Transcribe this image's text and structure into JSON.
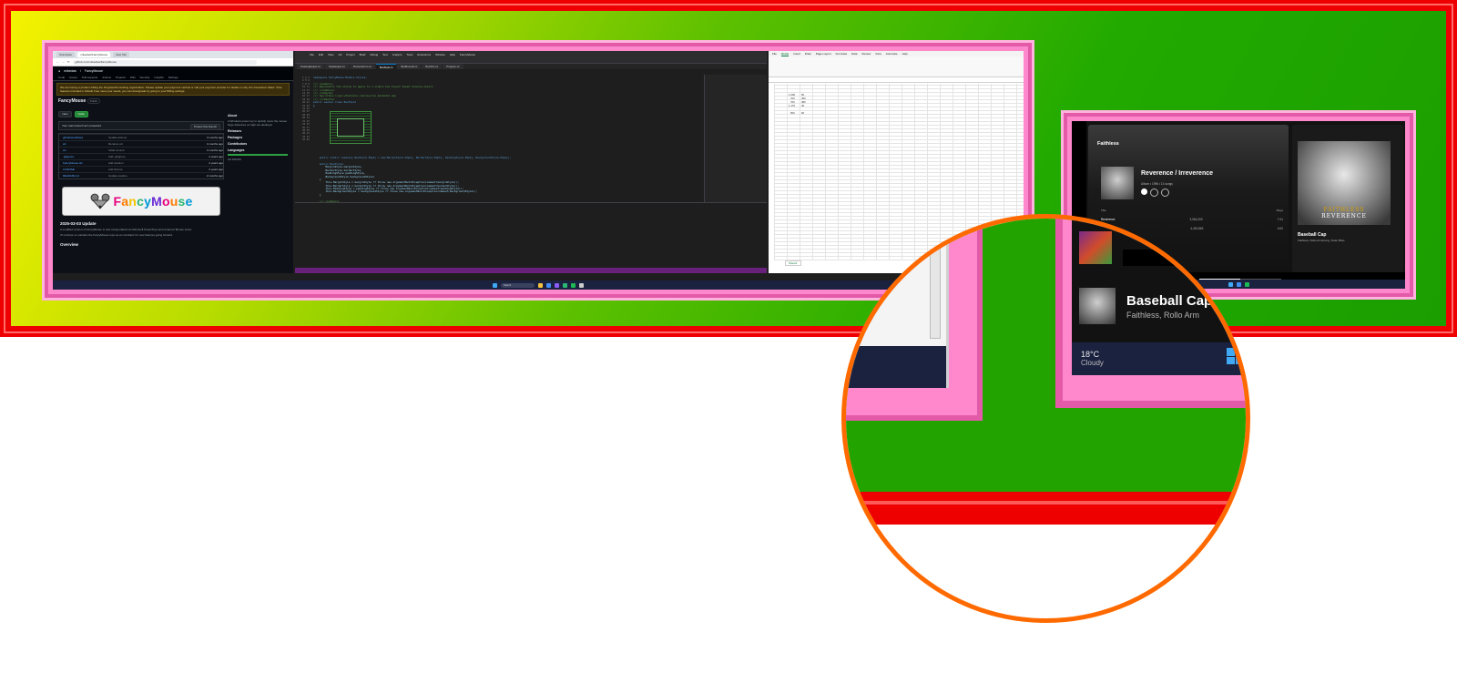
{
  "browser": {
    "tabs": [
      "Stumbelier",
      "mikedaw/FancyMouse",
      "New Tab"
    ],
    "url": "github.com/mikedaw/FancyMouse",
    "owner": "mikedaw",
    "repo": "FancyMouse",
    "nav": [
      "Code",
      "Issues",
      "Pull requests",
      "Actions",
      "Projects",
      "Wiki",
      "Security",
      "Insights",
      "Settings"
    ],
    "warning": "We are having a problem billing the KingslandConsulting organization. Please update your payment method or call your payment provider for details on why the transaction failed. If the features included in GitHub Free meet your needs, you can downgrade by going to your Billing settings.",
    "repo_title": "FancyMouse",
    "visibility": "Public",
    "branch": "main",
    "protect_title": "Your main branch isn't protected",
    "protect_button": "Protect this branch",
    "files": [
      {
        "name": "github/workflows",
        "msg": "Update actions",
        "time": "4 months ago"
      },
      {
        "name": "art",
        "msg": "Rename art",
        "time": "4 months ago"
      },
      {
        "name": "src",
        "msg": "Initial commit",
        "time": "4 months ago"
      },
      {
        "name": ".gitignore",
        "msg": "Add .gitignore",
        "time": "2 years ago"
      },
      {
        "name": "FancyMouse.sln",
        "msg": "Add solution",
        "time": "2 years ago"
      },
      {
        "name": "LICENSE",
        "msg": "Add license",
        "time": "2 years ago"
      },
      {
        "name": "README.md",
        "msg": "Update readme",
        "time": "2 months ago"
      }
    ],
    "logo_text": "FancyMouse",
    "readme_heading": "2025-03-03 Update",
    "readme_p1": "A modified version of FancyMouse is now incorporated into Microsoft PowerToys and renamed 'Mouse Jump'.",
    "readme_p2": "I'll continue to maintain the FancyMouse repo as an incubator for new features going forward.",
    "readme_heading2": "Overview",
    "about_title": "About",
    "about_text": "A Windows power toy to quickly move the mouse large distances on high-res desktops",
    "releases_title": "Releases",
    "packages_title": "Packages",
    "contributors_title": "Contributors",
    "languages_title": "Languages",
    "language": "C# 100.0%"
  },
  "ide": {
    "menu": [
      "File",
      "Edit",
      "View",
      "Git",
      "Project",
      "Build",
      "Debug",
      "Test",
      "Analyze",
      "Tools",
      "Extensions",
      "Window",
      "Help"
    ],
    "title": "FancyMouse",
    "tabs": [
      "DrawingHelper.cs",
      "StyleHelper.cs",
      "PreviewForm.cs",
      "BoxStyle.cs",
      "BoxBounds.cs",
      "BoxSize.cs",
      "Program.cs"
    ],
    "code_lines": [
      "namespace FancyMouse.Models.Styles;",
      "",
      "/// <summary>",
      "/// Represents the styles to apply to a simple box-layout based drawing object.",
      "/// </summary>",
      "/// <remarks>",
      "/// See https://www.w3schools.com/css/css_boxmodel.asp",
      "/// </remarks>",
      "public sealed class BoxStyle",
      "{",
      "",
      "",
      "",
      "",
      "",
      "",
      "",
      "",
      "",
      "",
      "",
      "",
      "",
      "",
      "",
      "",
      "    public static readonly BoxStyle Empty = new(MarginStyle.Empty, BorderStyle.Empty, PaddingStyle.Empty, BackgroundStyle.Empty);",
      "",
      "    public BoxStyle(",
      "        MarginStyle marginStyle,",
      "        BorderStyle borderStyle,",
      "        PaddingStyle paddingStyle,",
      "        BackgroundStyle backgroundStyle)",
      "    {",
      "        this.MarginStyle = marginStyle ?? throw new ArgumentNullException(nameof(marginStyle));",
      "        this.BorderStyle = borderStyle ?? throw new ArgumentNullException(nameof(borderStyle));",
      "        this.PaddingStyle = paddingStyle ?? throw new ArgumentNullException(nameof(paddingStyle));",
      "        this.BackgroundStyle = backgroundStyle ?? throw new ArgumentNullException(nameof(backgroundStyle));",
      "    }",
      "",
      "    /// <summary>",
      "    /// Gets the margin style for this layout box.",
      "    /// </summary>",
      "    public MarginStyle MarginStyle",
      "    {"
    ],
    "line_numbers": "1 2 3 4 5 6 7 8 9 10 11 12 13 14 15 16 17 18 19 20 21 22 23 24 25 26 27 28 29 30 31 32 33 34 35 36 37 38 39 40 41 42 43 44 45"
  },
  "excel": {
    "tabs": [
      "File",
      "Home",
      "Insert",
      "Draw",
      "Page Layout",
      "Formulas",
      "Data",
      "Review",
      "View",
      "Automate",
      "Help"
    ],
    "cells": [
      {
        "r": "1,000",
        "c": "50"
      },
      {
        "r": "700",
        "c": "450"
      },
      {
        "r": "700",
        "c": "380"
      },
      {
        "r": "1,170",
        "c": "40"
      },
      {
        "r": "500",
        "c": "60"
      }
    ],
    "sheet": "Sheet1"
  },
  "taskbar": {
    "search": "Search"
  },
  "music": {
    "artist": "Faithless",
    "album_title": "Reverence / Irreverence",
    "album_meta": "Album • 1996 • 13 songs",
    "col_title": "Title",
    "col_plays": "Plays",
    "tracks": [
      {
        "title": "Reverence",
        "artist": "Faithless",
        "plays": "3,064,200",
        "dur": "7:41"
      },
      {
        "title": "Don't Leave",
        "artist": "Faithless",
        "plays": "4,430,863",
        "dur": "4:00"
      }
    ],
    "cover_band": "FAITHLESS",
    "cover_album": "REVERENCE",
    "now_title": "Baseball Cap",
    "now_artist": "Faithless, Rollo Armstrong, Sister Bliss"
  },
  "magnifier": {
    "track_title": "Baseball Cap",
    "track_sub": "Faithless, Rollo Arm",
    "weather_temp": "18°C",
    "weather_desc": "Cloudy"
  },
  "colors": {
    "outer_frame": "#ee0000",
    "pink_frame": "#ff88cc",
    "magnifier_ring": "#ff6a00",
    "fill_top": "#f4f200",
    "fill_bottom": "#1b9e00"
  }
}
